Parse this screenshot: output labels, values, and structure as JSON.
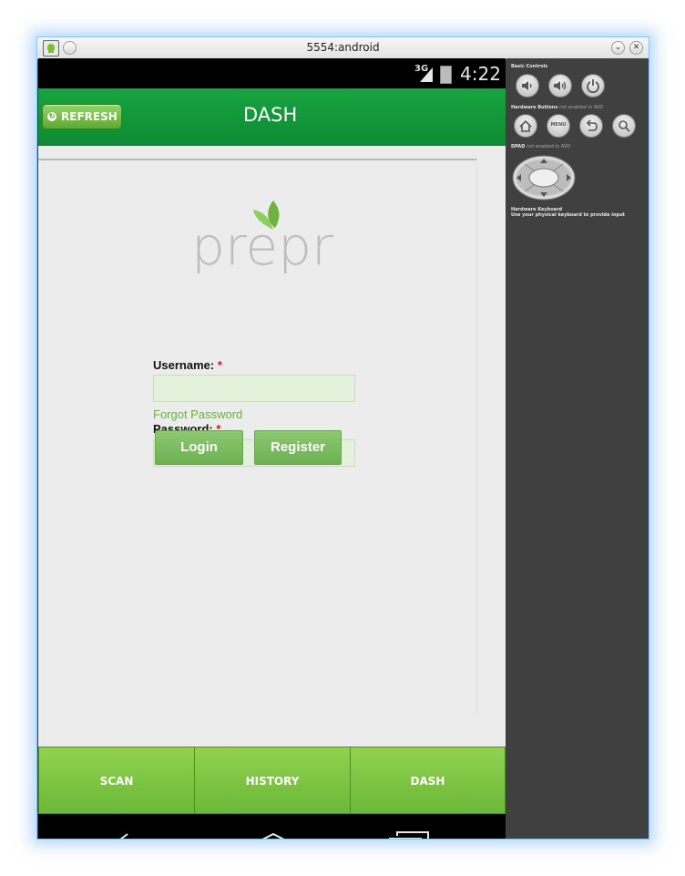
{
  "window": {
    "title": "5554:android"
  },
  "status_bar": {
    "network": "3G",
    "time": "4:22"
  },
  "app_bar": {
    "refresh_label": "REFRESH",
    "title": "DASH"
  },
  "logo": {
    "text": "prepr"
  },
  "login": {
    "username_label": "Username:",
    "password_label": "Password:",
    "required_mark": "*",
    "username_value": "",
    "password_value": "",
    "forgot_link": "Forgot Password",
    "login_button": "Login",
    "register_button": "Register"
  },
  "bottom_tabs": [
    {
      "label": "SCAN"
    },
    {
      "label": "HISTORY"
    },
    {
      "label": "DASH"
    }
  ],
  "emulator_panel": {
    "basic_controls": "Basic Controls",
    "hardware_buttons": "Hardware Buttons",
    "hardware_buttons_note": "not enabled in AVD",
    "menu_label": "MENU",
    "dpad": "DPAD",
    "dpad_note": "not enabled in AVD",
    "keyboard_title": "Hardware Keyboard",
    "keyboard_note": "Use your physical keyboard to provide input"
  },
  "colors": {
    "app_bar": "#129b3b",
    "tab_green": "#7ac142",
    "logo_gray": "#bdbdbd",
    "logo_green": "#6cb33f",
    "input_bg": "#e3f0da"
  }
}
